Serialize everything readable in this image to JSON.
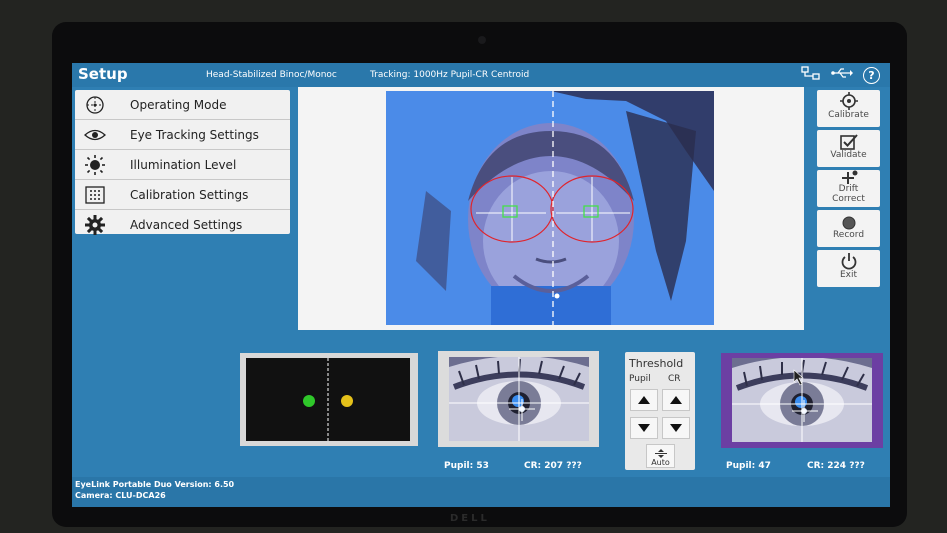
{
  "header": {
    "title": "Setup",
    "mode": "Head-Stabilized Binoc/Monoc",
    "tracking": "Tracking: 1000Hz Pupil-CR Centroid",
    "icons": [
      "network-icon",
      "usb-icon",
      "help-icon"
    ],
    "help_glyph": "?"
  },
  "menu": {
    "items": [
      {
        "label": "Operating Mode",
        "icon": "operating-mode-icon"
      },
      {
        "label": "Eye Tracking Settings",
        "icon": "eye-icon"
      },
      {
        "label": "Illumination Level",
        "icon": "illumination-icon"
      },
      {
        "label": "Calibration Settings",
        "icon": "calibration-grid-icon"
      },
      {
        "label": "Advanced Settings",
        "icon": "gear-icon"
      }
    ]
  },
  "actions": {
    "calibrate": "Calibrate",
    "validate": "Validate",
    "drift_line1": "Drift",
    "drift_line2": "Correct",
    "record": "Record",
    "exit": "Exit"
  },
  "eyes": {
    "left": {
      "pupil": "Pupil:  53",
      "cr": "CR: 207 ???"
    },
    "right": {
      "pupil": "Pupil:  47",
      "cr": "CR: 224 ???",
      "selected": true
    }
  },
  "threshold": {
    "title": "Threshold",
    "col_pupil": "Pupil",
    "col_cr": "CR",
    "auto_label": "Auto"
  },
  "footer": {
    "version": "EyeLink Portable Duo Version: 6.50",
    "camera": "Camera:  CLU-DCA26"
  },
  "colors": {
    "screen_bg": "#2f7fb3",
    "target_left": "#2fc72a",
    "target_right": "#e5c11a",
    "selected_border": "#6c3fa3",
    "cross": "#ffffff",
    "ellipse": "#e0242c"
  },
  "brand": "DELL"
}
